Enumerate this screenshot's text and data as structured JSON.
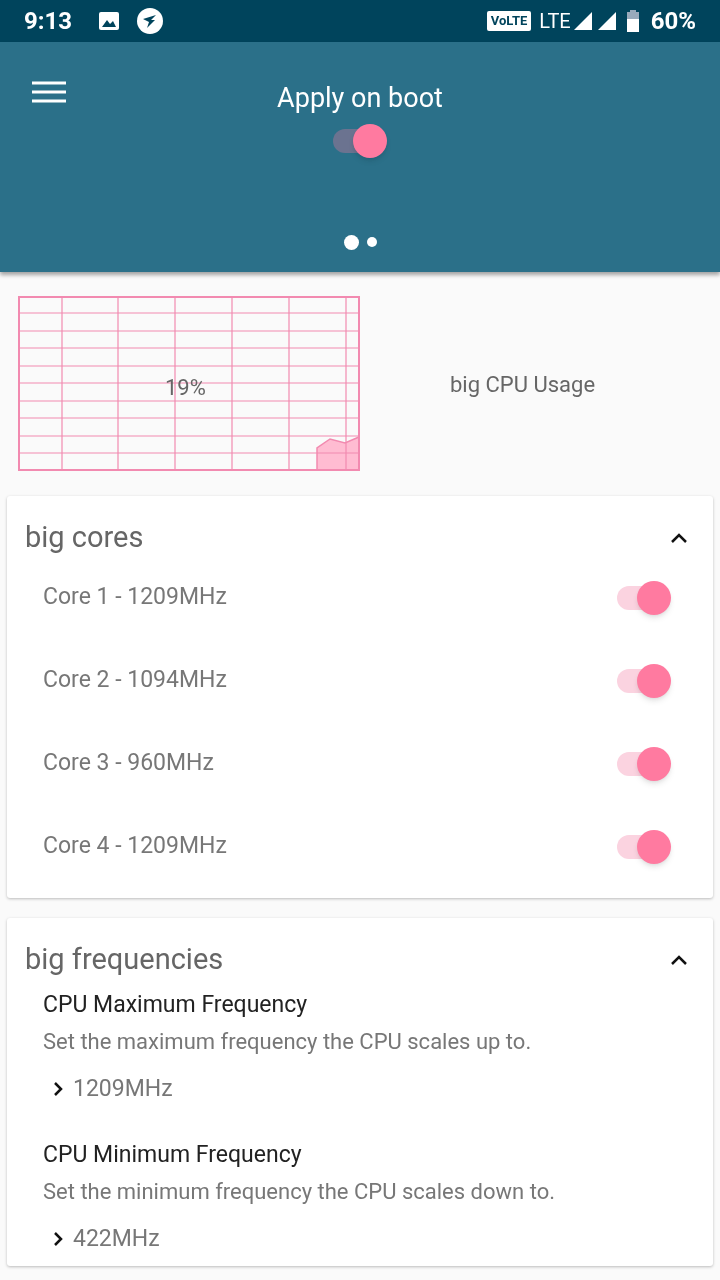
{
  "status_bar": {
    "time": "9:13",
    "network_badge": "VoLTE",
    "network": "LTE",
    "battery": "60%"
  },
  "header": {
    "title": "Apply on boot",
    "apply_on_boot": true,
    "pages": [
      {
        "selected": true
      },
      {
        "selected": false
      }
    ]
  },
  "usage": {
    "value": "19%",
    "label": "big CPU Usage"
  },
  "sections": [
    {
      "kind": "cores",
      "title": "big cores",
      "expanded": true,
      "items": [
        {
          "label": "Core 1 - 1209MHz",
          "on": true
        },
        {
          "label": "Core 2 - 1094MHz",
          "on": true
        },
        {
          "label": "Core 3 - 960MHz",
          "on": true
        },
        {
          "label": "Core 4 - 1209MHz",
          "on": true
        }
      ]
    },
    {
      "kind": "frequencies",
      "title": "big frequencies",
      "expanded": true,
      "items": [
        {
          "title": "CPU Maximum Frequency",
          "summary": "Set the maximum frequency the CPU scales up to.",
          "value": "1209MHz"
        },
        {
          "title": "CPU Minimum Frequency",
          "summary": "Set the minimum frequency the CPU scales down to.",
          "value": "422MHz"
        }
      ]
    }
  ]
}
